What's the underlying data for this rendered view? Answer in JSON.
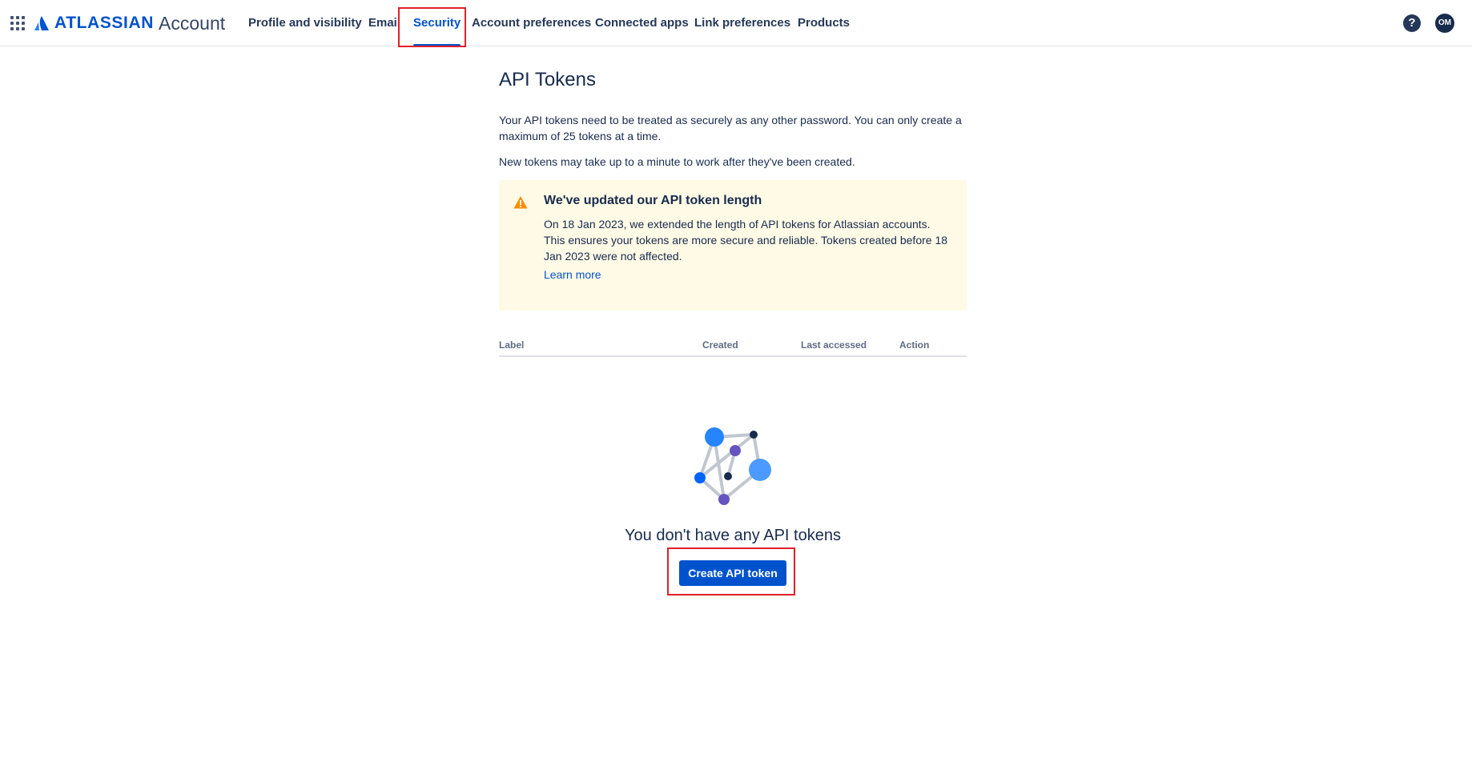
{
  "header": {
    "brand": "ATLASSIAN",
    "product": "Account",
    "nav": [
      {
        "label": "Profile and visibility"
      },
      {
        "label": "Email"
      },
      {
        "label": "Security",
        "active": true
      },
      {
        "label": "Account preferences"
      },
      {
        "label": "Connected apps"
      },
      {
        "label": "Link preferences"
      },
      {
        "label": "Products"
      }
    ],
    "help_icon": "help-icon",
    "help_glyph": "?",
    "avatar_initials": "OM"
  },
  "main": {
    "title": "API Tokens",
    "intro": "Your API tokens need to be treated as securely as any other password. You can only create a maximum of 25 tokens at a time.",
    "note": "New tokens may take up to a minute to work after they've been created.",
    "warning": {
      "icon": "warning-icon",
      "title": "We've updated our API token length",
      "body": "On 18 Jan 2023, we extended the length of API tokens for Atlassian accounts. This ensures your tokens are more secure and reliable. Tokens created before 18 Jan 2023 were not affected.",
      "link": "Learn more"
    },
    "table": {
      "columns": [
        "Label",
        "Created",
        "Last accessed",
        "Action"
      ]
    },
    "empty_state": {
      "title": "You don't have any API tokens",
      "button": "Create API token"
    }
  },
  "colors": {
    "brand": "#0052CC",
    "text": "#172B4D",
    "warning_bg": "#FFFAE6",
    "warning_icon": "#FF8B00",
    "highlight": "#E0202A"
  }
}
